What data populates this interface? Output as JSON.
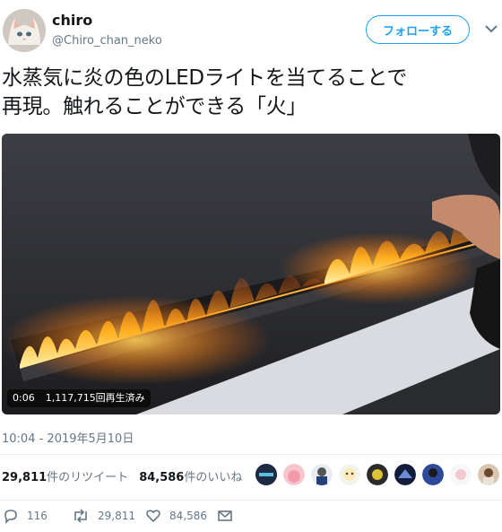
{
  "user": {
    "display_name": "chiro",
    "handle": "@Chiro_chan_neko",
    "avatar_icon": "cat-avatar"
  },
  "header": {
    "follow_label": "フォローする",
    "menu_icon": "chevron-down-icon"
  },
  "tweet": {
    "text_line1": "水蒸気に炎の色のLEDライトを当てることで",
    "text_line2": "再現。触れることができる「火」"
  },
  "video": {
    "elapsed": "0:06",
    "views": "1,117,715回再生済み"
  },
  "meta": {
    "timestamp": "10:04 - 2019年5月10日"
  },
  "stats": {
    "retweets_count": "29,811",
    "retweets_label": "件のリツイート",
    "likes_count": "84,586",
    "likes_label": "件のいいね"
  },
  "liked_by": [
    "avatar-1",
    "avatar-2",
    "avatar-3",
    "avatar-4",
    "avatar-5",
    "avatar-6",
    "avatar-7",
    "avatar-8",
    "avatar-9"
  ],
  "actions": {
    "reply_count": "116",
    "retweet_count": "29,811",
    "like_count": "84,586"
  },
  "colors": {
    "accent": "#1da1f2",
    "secondary_text": "#657786",
    "divider": "#e6ecf0"
  }
}
